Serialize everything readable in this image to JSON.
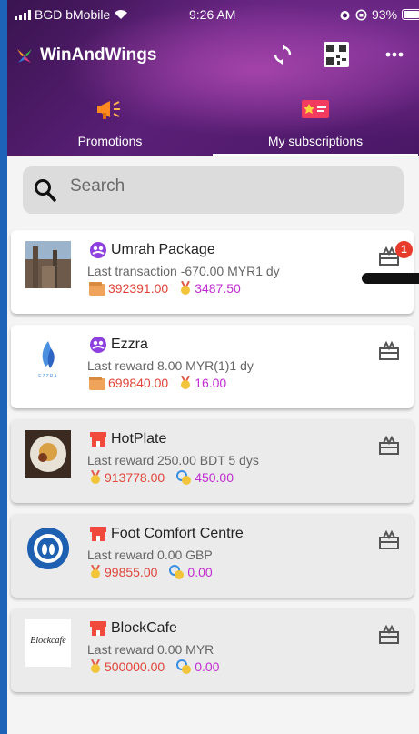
{
  "status_bar": {
    "carrier": "BGD bMobile",
    "time": "9:26 AM",
    "battery": "93%"
  },
  "header": {
    "app_name": "WinAndWings"
  },
  "tabs": [
    {
      "label": "Promotions"
    },
    {
      "label": "My subscriptions",
      "active": true
    }
  ],
  "search": {
    "placeholder": "Search"
  },
  "cards": [
    {
      "name": "Umrah Package",
      "subtitle": "Last transaction -670.00 MYR1 dy",
      "value1": "392391.00",
      "value2": "3487.50",
      "badge": "1"
    },
    {
      "name": "Ezzra",
      "subtitle": "Last reward 8.00 MYR(1)1 dy",
      "value1": "699840.00",
      "value2": "16.00",
      "logo_text": "EZZRA"
    },
    {
      "name": "HotPlate",
      "subtitle": "Last reward 250.00 BDT 5 dys",
      "value1": "913778.00",
      "value2": "450.00"
    },
    {
      "name": "Foot Comfort Centre",
      "subtitle": "Last reward 0.00 GBP",
      "value1": "99855.00",
      "value2": "0.00"
    },
    {
      "name": "BlockCafe",
      "subtitle": "Last reward 0.00 MYR",
      "value1": "500000.00",
      "value2": "0.00",
      "logo_text": "Blockcafe"
    }
  ],
  "icons": {
    "brand": "wings-logo-icon",
    "sync": "sync-icon",
    "qr": "qr-code-icon",
    "more": "more-icon",
    "promotions": "megaphone-icon",
    "subscriptions": "subscription-card-icon",
    "search": "search-icon",
    "gift": "gift-icon",
    "network": "network-group-icon",
    "store": "store-icon",
    "wallet": "wallet-icon",
    "medal": "medal-icon",
    "coin": "coin-icon"
  },
  "colors": {
    "header_purple": "#4a1766",
    "value_red": "#e0453a",
    "value_purple": "#c02dd0",
    "badge_red": "#e83b2c",
    "frame_blue": "#1d64b8"
  }
}
